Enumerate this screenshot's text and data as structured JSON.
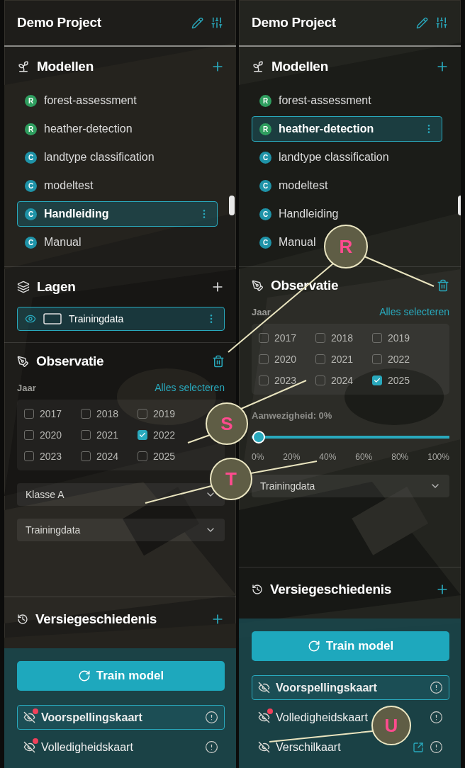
{
  "panels": [
    {
      "title": "Demo Project",
      "models": {
        "title": "Modellen",
        "items": [
          {
            "badge": "R",
            "color": "#2f9e5f",
            "name": "forest-assessment",
            "selected": false
          },
          {
            "badge": "R",
            "color": "#2f9e5f",
            "name": "heather-detection",
            "selected": false
          },
          {
            "badge": "C",
            "color": "#1f93a8",
            "name": "landtype classification",
            "selected": false
          },
          {
            "badge": "C",
            "color": "#1f93a8",
            "name": "modeltest",
            "selected": false
          },
          {
            "badge": "C",
            "color": "#1f93a8",
            "name": "Handleiding",
            "selected": true
          },
          {
            "badge": "C",
            "color": "#1f93a8",
            "name": "Manual",
            "selected": false
          }
        ]
      },
      "layers": {
        "title": "Lagen",
        "items": [
          {
            "name": "Trainingdata"
          }
        ]
      },
      "observation": {
        "title": "Observatie",
        "year_label": "Jaar",
        "select_all": "Alles selecteren",
        "years": [
          {
            "label": "2017",
            "checked": false
          },
          {
            "label": "2018",
            "checked": false
          },
          {
            "label": "2019",
            "checked": false
          },
          {
            "label": "2020",
            "checked": false
          },
          {
            "label": "2021",
            "checked": false
          },
          {
            "label": "2022",
            "checked": true
          },
          {
            "label": "2023",
            "checked": false
          },
          {
            "label": "2024",
            "checked": false
          },
          {
            "label": "2025",
            "checked": false
          }
        ],
        "controls": [
          {
            "kind": "dropdown",
            "value": "Klasse A"
          },
          {
            "kind": "dropdown",
            "value": "Trainingdata"
          }
        ]
      },
      "history": {
        "title": "Versiegeschiedenis"
      },
      "train_button": "Train model",
      "maps": [
        {
          "name": "Voorspellingskaart",
          "selected": true,
          "alert": true,
          "external_link": false
        },
        {
          "name": "Volledigheidskaart",
          "selected": false,
          "alert": true,
          "external_link": false
        }
      ]
    },
    {
      "title": "Demo Project",
      "models": {
        "title": "Modellen",
        "items": [
          {
            "badge": "R",
            "color": "#2f9e5f",
            "name": "forest-assessment",
            "selected": false
          },
          {
            "badge": "R",
            "color": "#2f9e5f",
            "name": "heather-detection",
            "selected": true
          },
          {
            "badge": "C",
            "color": "#1f93a8",
            "name": "landtype classification",
            "selected": false
          },
          {
            "badge": "C",
            "color": "#1f93a8",
            "name": "modeltest",
            "selected": false
          },
          {
            "badge": "C",
            "color": "#1f93a8",
            "name": "Handleiding",
            "selected": false
          },
          {
            "badge": "C",
            "color": "#1f93a8",
            "name": "Manual",
            "selected": false
          }
        ]
      },
      "observation": {
        "title": "Observatie",
        "year_label": "Jaar",
        "select_all": "Alles selecteren",
        "years": [
          {
            "label": "2017",
            "checked": false
          },
          {
            "label": "2018",
            "checked": false
          },
          {
            "label": "2019",
            "checked": false
          },
          {
            "label": "2020",
            "checked": false
          },
          {
            "label": "2021",
            "checked": false
          },
          {
            "label": "2022",
            "checked": false
          },
          {
            "label": "2023",
            "checked": false
          },
          {
            "label": "2024",
            "checked": false
          },
          {
            "label": "2025",
            "checked": true
          }
        ],
        "controls": [
          {
            "kind": "slider",
            "label": "Aanwezigheid: 0%",
            "level": 0,
            "ticks": [
              "0%",
              "20%",
              "40%",
              "60%",
              "80%",
              "100%"
            ]
          },
          {
            "kind": "dropdown",
            "value": "Trainingdata"
          }
        ]
      },
      "history": {
        "title": "Versiegeschiedenis"
      },
      "train_button": "Train model",
      "maps": [
        {
          "name": "Voorspellingskaart",
          "selected": true,
          "alert": false,
          "external_link": false
        },
        {
          "name": "Volledigheidskaart",
          "selected": false,
          "alert": true,
          "external_link": false
        },
        {
          "name": "Verschilkaart",
          "selected": false,
          "alert": false,
          "external_link": true
        }
      ]
    }
  ],
  "callouts": [
    {
      "label": "R"
    },
    {
      "label": "S"
    },
    {
      "label": "T"
    },
    {
      "label": "U"
    }
  ]
}
